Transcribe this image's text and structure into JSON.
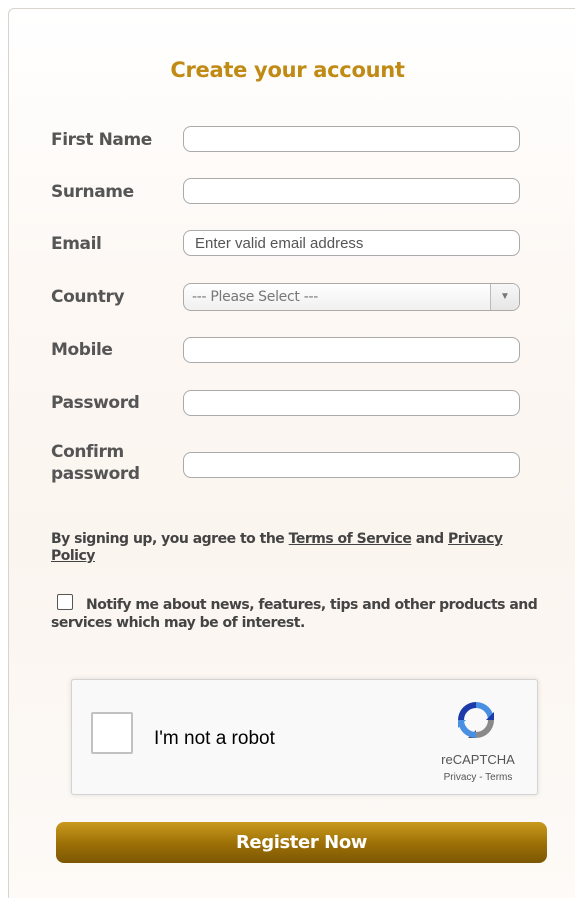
{
  "form": {
    "title": "Create your account",
    "fields": [
      {
        "label": "First Name",
        "value": "",
        "placeholder": ""
      },
      {
        "label": "Surname",
        "value": "",
        "placeholder": ""
      },
      {
        "label": "Email",
        "value": "",
        "placeholder": "Enter valid email address"
      },
      {
        "label": "Country",
        "selected": "--- Please Select ---"
      },
      {
        "label": "Mobile",
        "value": "",
        "placeholder": ""
      },
      {
        "label": "Password",
        "value": "",
        "placeholder": ""
      },
      {
        "label": "Confirm password",
        "label_line1": "Confirm",
        "label_line2": "password",
        "value": "",
        "placeholder": ""
      }
    ],
    "terms": {
      "prefix": "By signing up, you agree to the ",
      "tos_link": "Terms of Service",
      "middle": " and ",
      "privacy_link": "Privacy Policy"
    },
    "notify": {
      "checked": false,
      "text": "Notify me about news, features, tips and other products and services which may be of interest."
    },
    "captcha": {
      "label": "I'm not a robot",
      "brand": "reCAPTCHA",
      "privacy": "Privacy",
      "separator": " - ",
      "terms": "Terms"
    },
    "submit_label": "Register Now"
  },
  "colors": {
    "title": "#c08a14",
    "button_top": "#c99a1e",
    "button_bottom": "#7c5704",
    "label": "#555555"
  },
  "icons": {
    "select_arrow": "chevron-down-icon",
    "captcha_logo": "recaptcha-icon"
  }
}
